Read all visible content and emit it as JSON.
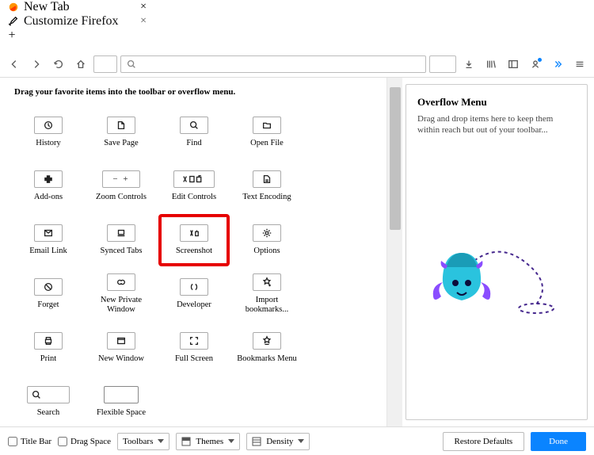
{
  "tabs": {
    "newtab": "New Tab",
    "customize": "Customize Firefox"
  },
  "instruction": "Drag your favorite items into the toolbar or overflow menu.",
  "items": {
    "history": "History",
    "savepage": "Save Page",
    "find": "Find",
    "openfile": "Open File",
    "addons": "Add-ons",
    "zoom": "Zoom Controls",
    "editcontrols": "Edit Controls",
    "textencoding": "Text Encoding",
    "emaillink": "Email Link",
    "syncedtabs": "Synced Tabs",
    "screenshot": "Screenshot",
    "options": "Options",
    "forget": "Forget",
    "newprivate": "New Private Window",
    "developer": "Developer",
    "importbookmarks": "Import bookmarks...",
    "print": "Print",
    "newwindow": "New Window",
    "fullscreen": "Full Screen",
    "bookmarksmenu": "Bookmarks Menu",
    "search": "Search",
    "flexspace": "Flexible Space"
  },
  "overflow": {
    "title": "Overflow Menu",
    "desc": "Drag and drop items here to keep them within reach but out of your toolbar..."
  },
  "bottom": {
    "titlebar": "Title Bar",
    "dragspace": "Drag Space",
    "toolbars": "Toolbars",
    "themes": "Themes",
    "density": "Density",
    "restore": "Restore Defaults",
    "done": "Done"
  }
}
